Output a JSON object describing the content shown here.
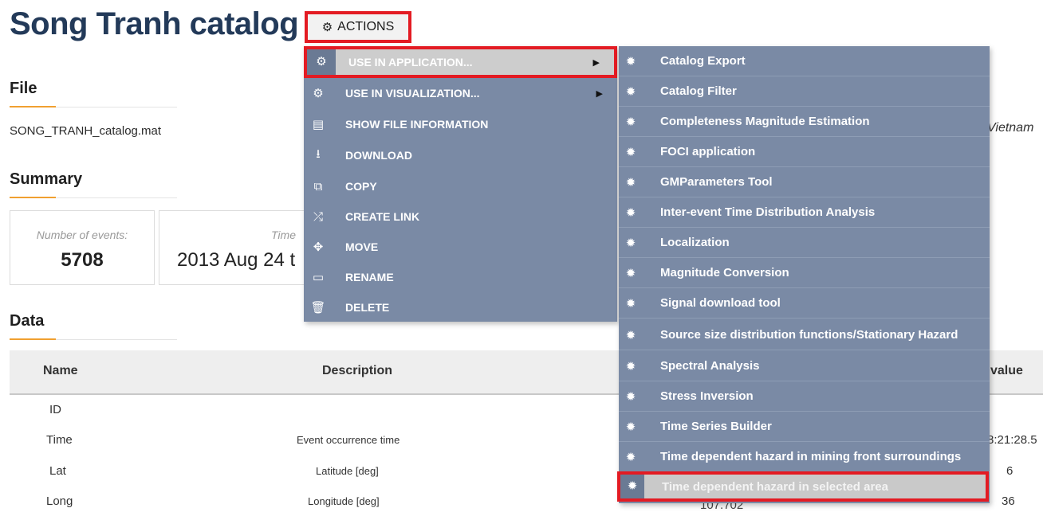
{
  "page": {
    "title": "Song Tranh catalog",
    "actions_label": "ACTIONS"
  },
  "file": {
    "heading": "File",
    "filename": "SONG_TRANH_catalog.mat",
    "region_fragment": "Vietnam"
  },
  "summary": {
    "heading": "Summary",
    "events_label": "Number of events:",
    "events_value": "5708",
    "time_label": "Time",
    "time_value": "2013 Aug 24 t"
  },
  "data": {
    "heading": "Data",
    "columns": {
      "name": "Name",
      "description": "Description",
      "value": "value"
    },
    "rows": [
      {
        "name": "ID",
        "description": "",
        "value": ""
      },
      {
        "name": "Time",
        "description": "Event occurrence time",
        "value": "8:21:28.5"
      },
      {
        "name": "Lat",
        "description": "Latitude [deg]",
        "value": "6"
      },
      {
        "name": "Long",
        "description": "Longitude [deg]",
        "value": "36",
        "mid_value": "107.702"
      }
    ]
  },
  "menu": {
    "items": [
      {
        "label": "USE IN APPLICATION...",
        "icon": "cogs-icon",
        "has_sub": true,
        "active": true
      },
      {
        "label": "USE IN VISUALIZATION...",
        "icon": "cogs-icon",
        "has_sub": true
      },
      {
        "label": "SHOW FILE INFORMATION",
        "icon": "file-text-icon"
      },
      {
        "label": "DOWNLOAD",
        "icon": "download-icon"
      },
      {
        "label": "COPY",
        "icon": "copy-icon"
      },
      {
        "label": "CREATE LINK",
        "icon": "shuffle-icon"
      },
      {
        "label": "MOVE",
        "icon": "move-arrows-icon"
      },
      {
        "label": "RENAME",
        "icon": "folder-icon"
      },
      {
        "label": "DELETE",
        "icon": "trash-icon"
      }
    ]
  },
  "submenu": {
    "items": [
      "Catalog Export",
      "Catalog Filter",
      "Completeness Magnitude Estimation",
      "FOCI application",
      "GMParameters Tool",
      "Inter-event Time Distribution Analysis",
      "Localization",
      "Magnitude Conversion",
      "Signal download tool",
      "Source size distribution functions/Stationary Hazard",
      "Spectral Analysis",
      "Stress Inversion",
      "Time Series Builder",
      "Time dependent hazard in mining front surroundings",
      "Time dependent hazard in selected area"
    ],
    "highlighted_index": 14
  },
  "colors": {
    "title": "#233a59",
    "menu_bg": "#7a8aa5",
    "highlight_border": "#e31b23",
    "accent_underline": "#f0a030"
  }
}
